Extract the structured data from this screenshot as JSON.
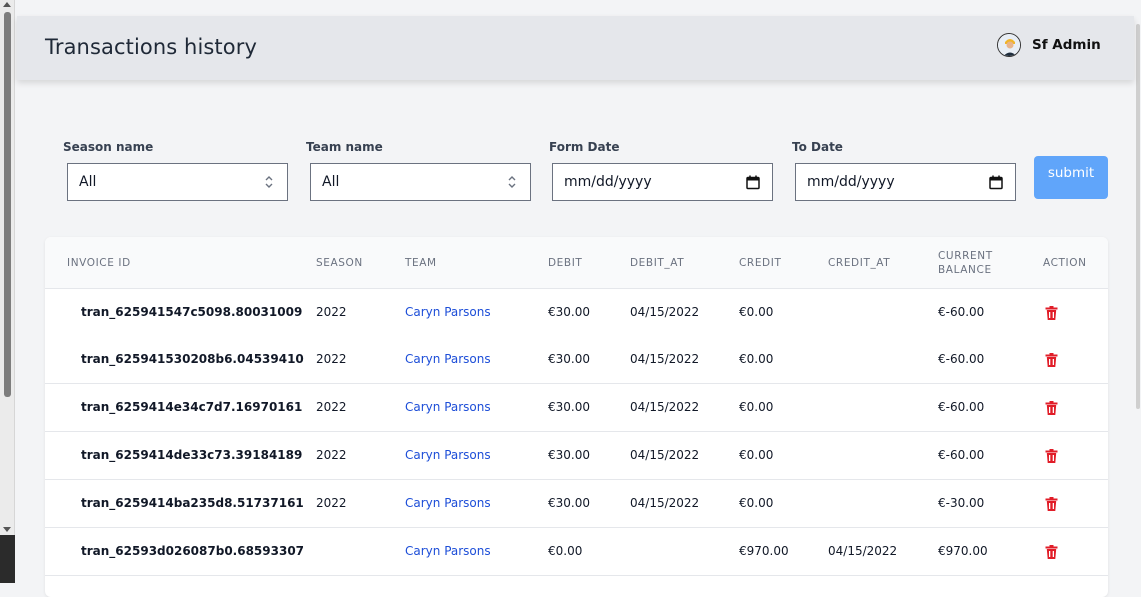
{
  "header": {
    "title": "Transactions history",
    "user_name": "Sf Admin"
  },
  "filters": {
    "season": {
      "label": "Season name",
      "value": "All"
    },
    "team": {
      "label": "Team name",
      "value": "All"
    },
    "from_date": {
      "label": "Form Date",
      "placeholder": "mm/dd/yyyy"
    },
    "to_date": {
      "label": "To Date",
      "placeholder": "mm/dd/yyyy"
    },
    "submit_label": "submit"
  },
  "table": {
    "headers": {
      "invoice": "INVOICE ID",
      "season": "SEASON",
      "team": "TEAM",
      "debit": "DEBIT",
      "debit_at": "DEBIT_AT",
      "credit": "CREDIT",
      "credit_at": "CREDIT_AT",
      "balance_line1": "CURRENT",
      "balance_line2": "BALANCE",
      "action": "ACTION"
    },
    "rows": [
      {
        "invoice": "tran_625941547c5098.80031009",
        "season": "2022",
        "team": "Caryn Parsons",
        "debit": "€30.00",
        "debit_at": "04/15/2022",
        "credit": "€0.00",
        "credit_at": "",
        "balance": "€-60.00"
      },
      {
        "invoice": "tran_625941530208b6.04539410",
        "season": "2022",
        "team": "Caryn Parsons",
        "debit": "€30.00",
        "debit_at": "04/15/2022",
        "credit": "€0.00",
        "credit_at": "",
        "balance": "€-60.00"
      },
      {
        "invoice": "tran_6259414e34c7d7.16970161",
        "season": "2022",
        "team": "Caryn Parsons",
        "debit": "€30.00",
        "debit_at": "04/15/2022",
        "credit": "€0.00",
        "credit_at": "",
        "balance": "€-60.00"
      },
      {
        "invoice": "tran_6259414de33c73.39184189",
        "season": "2022",
        "team": "Caryn Parsons",
        "debit": "€30.00",
        "debit_at": "04/15/2022",
        "credit": "€0.00",
        "credit_at": "",
        "balance": "€-60.00"
      },
      {
        "invoice": "tran_6259414ba235d8.51737161",
        "season": "2022",
        "team": "Caryn Parsons",
        "debit": "€30.00",
        "debit_at": "04/15/2022",
        "credit": "€0.00",
        "credit_at": "",
        "balance": "€-30.00"
      },
      {
        "invoice": "tran_62593d026087b0.68593307",
        "season": "",
        "team": "Caryn Parsons",
        "debit": "€0.00",
        "debit_at": "",
        "credit": "€970.00",
        "credit_at": "04/15/2022",
        "balance": "€970.00"
      }
    ]
  },
  "colors": {
    "accent": "#60a5fa",
    "link": "#1d4ed8",
    "delete": "#e11d28"
  },
  "icons": {
    "avatar": "avatar",
    "select": "chevron-up-down-icon",
    "date": "calendar-icon",
    "delete": "trash-icon"
  }
}
